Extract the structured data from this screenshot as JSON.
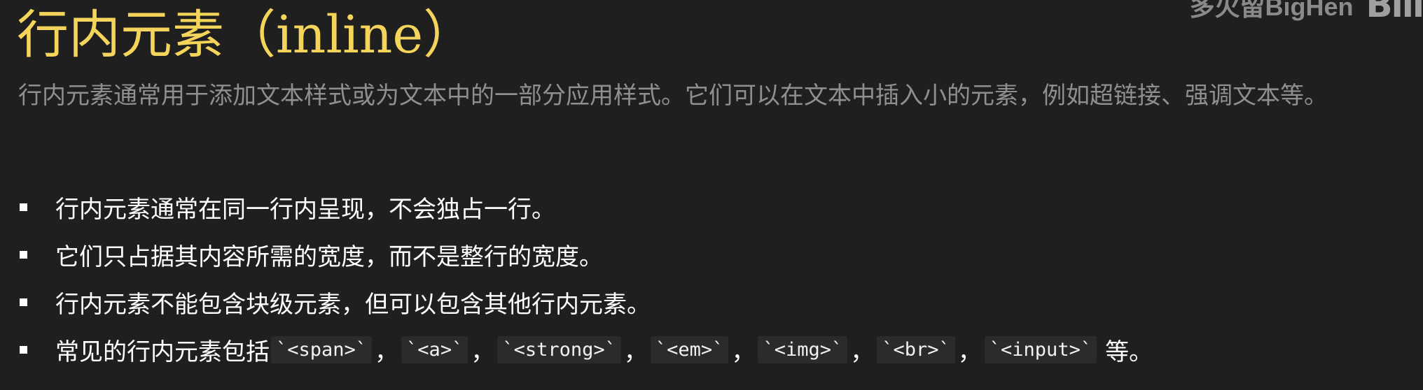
{
  "watermark": {
    "author": "多火留BigHen",
    "logo": "Bili"
  },
  "title": {
    "cjk": "行内元素",
    "latin": "（inline）"
  },
  "intro": "行内元素通常用于添加文本样式或为文本中的一部分应用样式。它们可以在文本中插入小的元素，例如超链接、强调文本等。",
  "bullets": [
    "行内元素通常在同一行内呈现，不会独占一行。",
    "它们只占据其内容所需的宽度，而不是整行的宽度。",
    "行内元素不能包含块级元素，但可以包含其他行内元素。"
  ],
  "examples": {
    "lead": "常见的行内元素包括",
    "tags": [
      "`<span>`",
      "`<a>`",
      "`<strong>`",
      "`<em>`",
      "`<img>`",
      "`<br>`",
      "`<input>`"
    ],
    "separator": "，",
    "trail": "等。"
  }
}
